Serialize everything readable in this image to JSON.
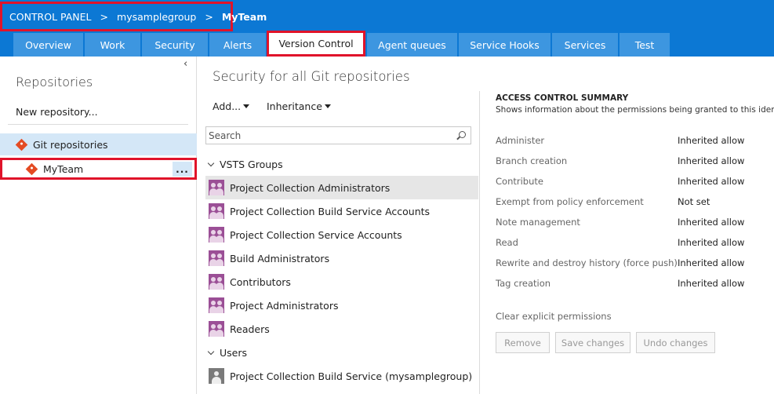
{
  "breadcrumb": {
    "item1": "CONTROL PANEL",
    "sep": ">",
    "item2": "mysamplegroup",
    "item3": "MyTeam"
  },
  "tabs": [
    {
      "label": "Overview"
    },
    {
      "label": "Work"
    },
    {
      "label": "Security"
    },
    {
      "label": "Alerts"
    },
    {
      "label": "Version Control"
    },
    {
      "label": "Agent queues"
    },
    {
      "label": "Service Hooks"
    },
    {
      "label": "Services"
    },
    {
      "label": "Test"
    }
  ],
  "left": {
    "collapse_glyph": "‹",
    "title": "Repositories",
    "new_repo": "New repository...",
    "git_repos": "Git repositories",
    "myteam": "MyTeam",
    "more": "..."
  },
  "middle": {
    "title": "Security for all Git repositories",
    "add": "Add...",
    "inheritance": "Inheritance",
    "search_placeholder": "Search",
    "groups_header": "VSTS Groups",
    "groups": [
      "Project Collection Administrators",
      "Project Collection Build Service Accounts",
      "Project Collection Service Accounts",
      "Build Administrators",
      "Contributors",
      "Project Administrators",
      "Readers"
    ],
    "users_header": "Users",
    "users": [
      "Project Collection Build Service (mysamplegroup)"
    ]
  },
  "summary": {
    "title": "ACCESS CONTROL SUMMARY",
    "description": "Shows information about the permissions being granted to this identity",
    "permissions": [
      {
        "name": "Administer",
        "value": "Inherited allow"
      },
      {
        "name": "Branch creation",
        "value": "Inherited allow"
      },
      {
        "name": "Contribute",
        "value": "Inherited allow"
      },
      {
        "name": "Exempt from policy enforcement",
        "value": "Not set"
      },
      {
        "name": "Note management",
        "value": "Inherited allow"
      },
      {
        "name": "Read",
        "value": "Inherited allow"
      },
      {
        "name": "Rewrite and destroy history (force push)",
        "value": "Inherited allow"
      },
      {
        "name": "Tag creation",
        "value": "Inherited allow"
      }
    ],
    "clear": "Clear explicit permissions",
    "remove": "Remove",
    "save": "Save changes",
    "undo": "Undo changes"
  },
  "colors": {
    "header_blue": "#0c78d4",
    "tab_blue": "#3d96e0",
    "highlight_red": "#e0132a",
    "selection_blue": "#d4e7f7",
    "group_purple": "#9b4f96",
    "git_orange": "#e44b23"
  }
}
